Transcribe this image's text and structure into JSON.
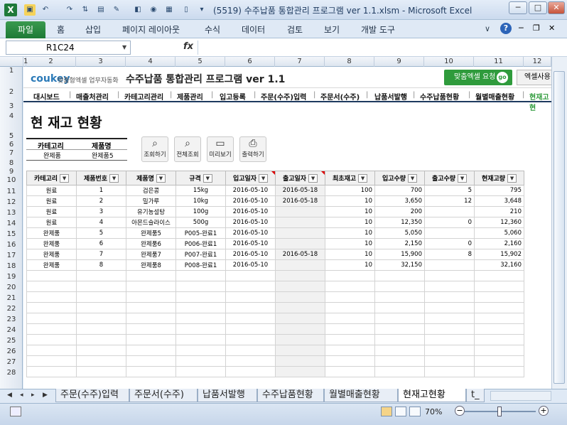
{
  "window": {
    "title": "(5519) 수주납품 통합관리 프로그램 ver 1.1.xlsm  -  Microsoft Excel",
    "app_icon": "X",
    "min_label": "─",
    "max_label": "□",
    "close_label": "✕"
  },
  "ribbon": {
    "file_tab": "파일",
    "tabs": [
      "홈",
      "삽입",
      "페이지 레이아웃",
      "수식",
      "데이터",
      "검토",
      "보기",
      "개발 도구"
    ]
  },
  "formula_bar": {
    "name_box": "R1C24",
    "fx": "fx",
    "formula": ""
  },
  "columns": [
    "1",
    "2",
    "3",
    "4",
    "5",
    "6",
    "7",
    "8",
    "9",
    "10",
    "11",
    "12"
  ],
  "rows": [
    "1",
    "2",
    "3",
    "4",
    "5",
    "6",
    "7",
    "8",
    "9",
    "10",
    "11",
    "12",
    "13",
    "14",
    "15",
    "16",
    "17",
    "18",
    "19",
    "20",
    "21",
    "22",
    "23",
    "24",
    "25",
    "26",
    "27",
    "28"
  ],
  "brand": {
    "logo": "coukey",
    "logo_sub": "맞춤형엑셀 업무자동화",
    "app_title": "수주납품 통합관리 프로그램 ver 1.1",
    "request_btn": "맞춤엑셀 요청",
    "request_go": "go",
    "excel_btn": "엑셀사용"
  },
  "nav": [
    "대시보드",
    "매출처관리",
    "카테고리관리",
    "제품관리",
    "입고등록",
    "주문(수주)입력",
    "주문서(수주)",
    "납품서발행",
    "수주납품현황",
    "월별매출현황",
    "현재고현"
  ],
  "page": {
    "heading": "현 재고 현황"
  },
  "filter": {
    "category_label": "카테고리",
    "product_label": "제품명",
    "category_value": "완제품",
    "product_value": "완제품5"
  },
  "actions": [
    {
      "label": "조회하기",
      "icon": "search-icon"
    },
    {
      "label": "전체조회",
      "icon": "search-all-icon"
    },
    {
      "label": "미리보기",
      "icon": "monitor-icon"
    },
    {
      "label": "출력하기",
      "icon": "printer-icon"
    }
  ],
  "table": {
    "headers": [
      "카테고리",
      "제품번호",
      "제품명",
      "규격",
      "입고일자",
      "출고일자",
      "최초재고",
      "입고수량",
      "출고수량",
      "현재고량"
    ],
    "rows": [
      [
        "원료",
        "1",
        "검은콩",
        "15kg",
        "2016-05-10",
        "2016-05-18",
        "100",
        "700",
        "5",
        "795"
      ],
      [
        "원료",
        "2",
        "밀가루",
        "10kg",
        "2016-05-10",
        "2016-05-18",
        "10",
        "3,650",
        "12",
        "3,648"
      ],
      [
        "원료",
        "3",
        "유기농설탕",
        "100g",
        "2016-05-10",
        "",
        "10",
        "200",
        "",
        "210"
      ],
      [
        "원료",
        "4",
        "아몬드슬라이스",
        "500g",
        "2016-05-10",
        "",
        "10",
        "12,350",
        "0",
        "12,360"
      ],
      [
        "완제품",
        "5",
        "완제품5",
        "P005-완료1",
        "2016-05-10",
        "",
        "10",
        "5,050",
        "",
        "5,060"
      ],
      [
        "완제품",
        "6",
        "완제품6",
        "P006-완료1",
        "2016-05-10",
        "",
        "10",
        "2,150",
        "0",
        "2,160"
      ],
      [
        "완제품",
        "7",
        "완제품7",
        "P007-완료1",
        "2016-05-10",
        "2016-05-18",
        "10",
        "15,900",
        "8",
        "15,902"
      ],
      [
        "완제품",
        "8",
        "완제품8",
        "P008-완료1",
        "2016-05-10",
        "",
        "10",
        "32,150",
        "",
        "32,160"
      ]
    ],
    "empty_rows": 10
  },
  "sheet_tabs": [
    "주문(수주)입력",
    "주문서(수주)",
    "납품서발행",
    "수주납품현황",
    "월별매출현황",
    "현재고현황",
    "t_매"
  ],
  "active_sheet": "현재고현황",
  "status": {
    "zoom": "70%",
    "zoom_minus": "−",
    "zoom_plus": "+"
  }
}
